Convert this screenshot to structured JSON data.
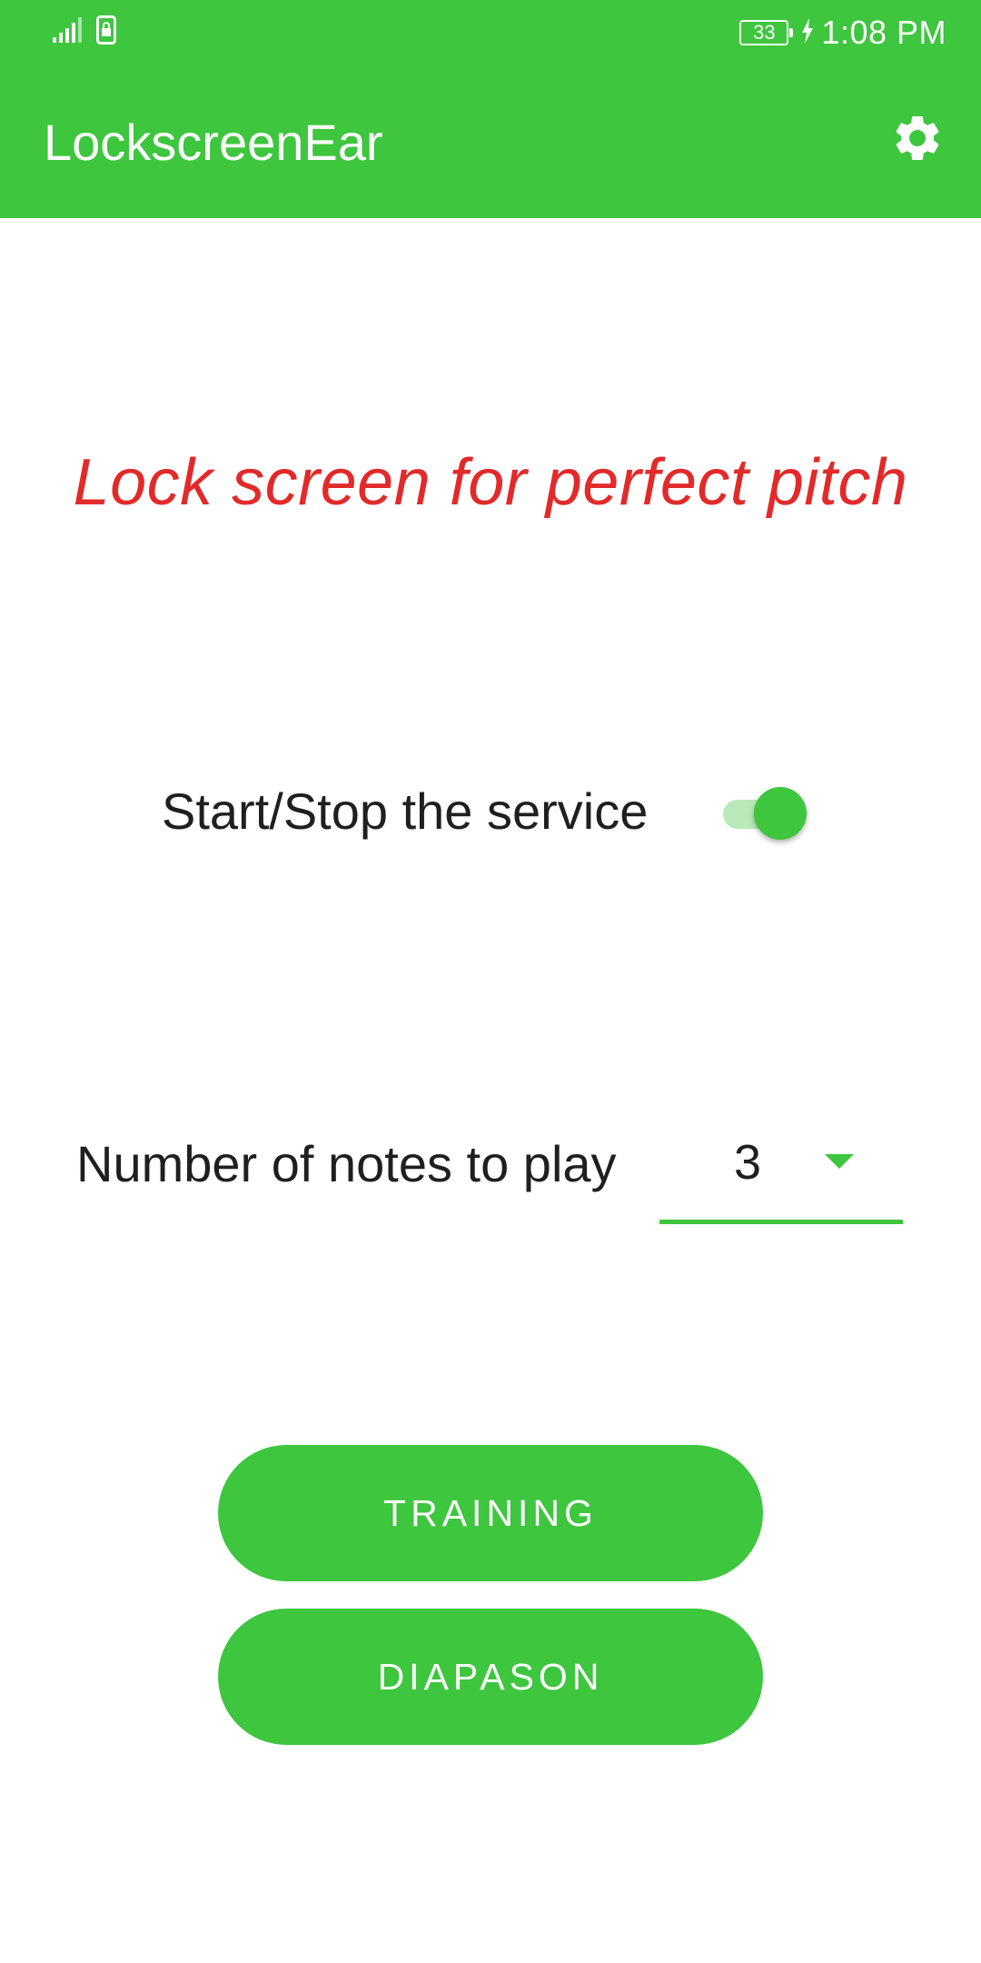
{
  "status_bar": {
    "time": "1:08 PM",
    "battery_level": "33",
    "icons": [
      "signal-icon",
      "sim-lock-icon",
      "battery-icon",
      "charging-icon"
    ]
  },
  "app_bar": {
    "title": "LockscreenEar",
    "settings_icon": "gear-icon"
  },
  "main": {
    "tagline": "Lock screen for perfect pitch",
    "service_toggle": {
      "label": "Start/Stop the service",
      "checked": true
    },
    "notes_selector": {
      "label": "Number of notes to play",
      "selected_value": "3"
    },
    "buttons": {
      "training": "TRAINING",
      "diapason": "DIAPASON"
    }
  },
  "colors": {
    "primary": "#3DC63E",
    "accent_text": "#E22A2A",
    "switch_track": "#B9E9B9",
    "text": "#1f1f1f",
    "background": "#ffffff"
  }
}
